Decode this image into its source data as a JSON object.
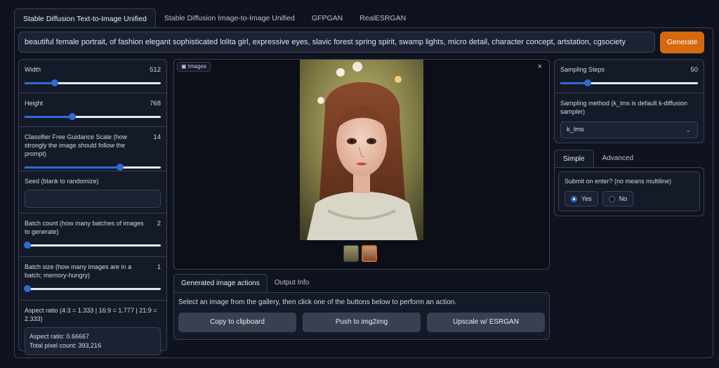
{
  "tabs": [
    {
      "label": "Stable Diffusion Text-to-Image Unified"
    },
    {
      "label": "Stable Diffusion Image-to-Image Unified"
    },
    {
      "label": "GFPGAN"
    },
    {
      "label": "RealESRGAN"
    }
  ],
  "prompt": {
    "value": "beautiful female portrait, of fashion elegant sophisticated lolita girl, expressive eyes, slavic forest spring spirit, swamp lights, micro detail, character concept, artstation, cgsociety"
  },
  "generate_label": "Generate",
  "left": {
    "width": {
      "label": "Width",
      "value": "512",
      "fraction": 0.22
    },
    "height": {
      "label": "Height",
      "value": "768",
      "fraction": 0.35
    },
    "cfg": {
      "label": "Classifier Free Guidance Scale (how strongly the image should follow the prompt)",
      "value": "14",
      "fraction": 0.7
    },
    "seed": {
      "label": "Seed (blank to randomize)",
      "value": ""
    },
    "batch_count": {
      "label": "Batch count (how many batches of images to generate)",
      "value": "2",
      "fraction": 0.02
    },
    "batch_size": {
      "label": "Batch size (how many images are in a batch; memory-hungry)",
      "value": "1",
      "fraction": 0.02
    },
    "aspect": {
      "label": "Aspect ratio (4:3 = 1.333 | 16:9 = 1.777 | 21:9 = 2.333)",
      "ratio": "Aspect ratio: 0.66667",
      "pixels": "Total pixel count: 393,216"
    }
  },
  "gallery": {
    "label": "Images",
    "close": "×"
  },
  "actions": {
    "tabs": [
      {
        "label": "Generated image actions"
      },
      {
        "label": "Output Info"
      }
    ],
    "hint": "Select an image from the gallery, then click one of the buttons below to perform an action.",
    "buttons": [
      {
        "label": "Copy to clipboard"
      },
      {
        "label": "Push to img2img"
      },
      {
        "label": "Upscale w/ ESRGAN"
      }
    ]
  },
  "right": {
    "steps": {
      "label": "Sampling Steps",
      "value": "50",
      "fraction": 0.2
    },
    "method": {
      "label": "Sampling method (k_lms is default k-diffusion sampler)",
      "value": "k_lms"
    },
    "tabs": [
      {
        "label": "Simple"
      },
      {
        "label": "Advanced"
      }
    ],
    "submit": {
      "label": "Submit on enter? (no means multiline)",
      "options": [
        {
          "label": "Yes",
          "selected": true
        },
        {
          "label": "No",
          "selected": false
        }
      ]
    }
  },
  "colors": {
    "accent": "#d6680e",
    "slider": "#2f6bd6",
    "background": "#0f1320"
  },
  "icons": {
    "gallery": "image-icon",
    "close": "close-icon",
    "select": "chevron-down-icon"
  }
}
